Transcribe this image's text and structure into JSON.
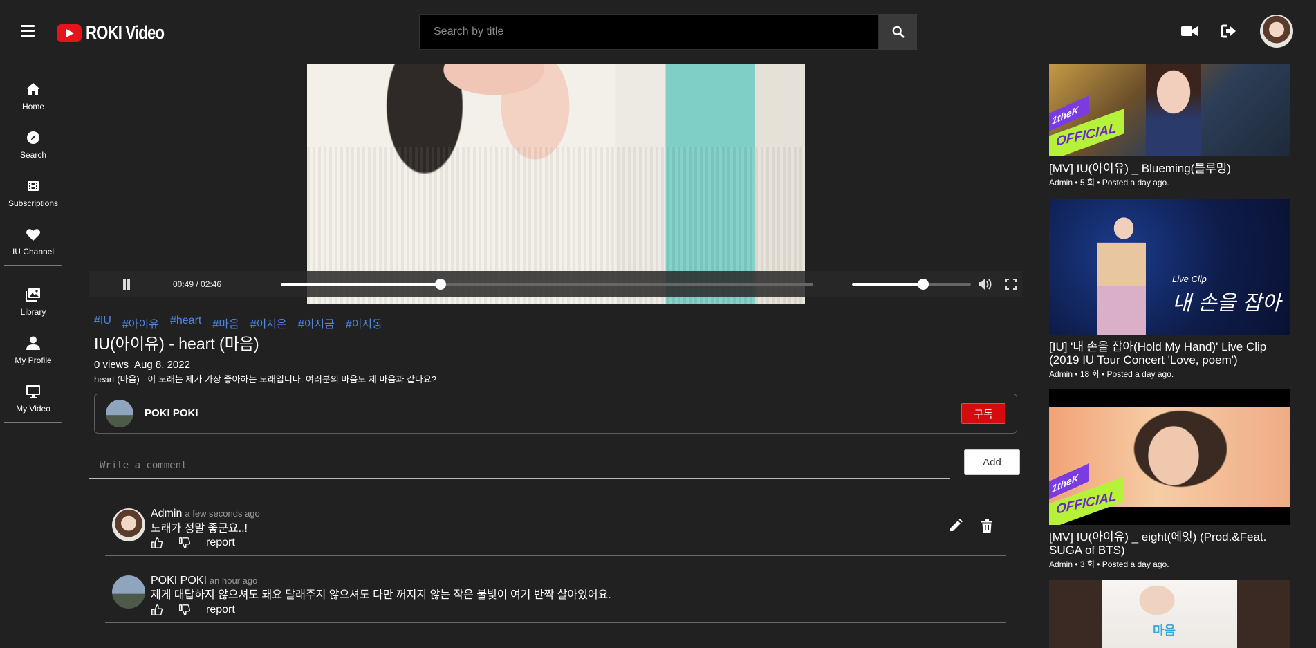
{
  "app": {
    "name": "ROKI Video"
  },
  "search": {
    "placeholder": "Search by title"
  },
  "sidebar": {
    "items": [
      {
        "label": "Home",
        "icon": "home-icon"
      },
      {
        "label": "Search",
        "icon": "compass-icon"
      },
      {
        "label": "Subscriptions",
        "icon": "film-icon"
      },
      {
        "label": "IU Channel",
        "icon": "heart-icon"
      },
      {
        "label": "Library",
        "icon": "photo-library-icon"
      },
      {
        "label": "My Profile",
        "icon": "user-icon"
      },
      {
        "label": "My Video",
        "icon": "monitor-icon"
      }
    ]
  },
  "player": {
    "time": "00:49 / 02:46",
    "progress": 0.3,
    "volume": 0.6
  },
  "video": {
    "tags": [
      "#IU",
      "#아이유",
      "#heart",
      "#마음",
      "#이지은",
      "#이지금",
      "#이지동"
    ],
    "title": "IU(아이유) - heart (마음)",
    "views": "0 views",
    "date": "Aug 8, 2022",
    "description": "heart (마음) - 이 노래는 제가 가장 좋아하는 노래입니다. 여러분의 마음도 제 마음과 같나요?"
  },
  "channel": {
    "name": "POKI POKI",
    "subscribe_label": "구독"
  },
  "comment_form": {
    "placeholder": "Write a comment",
    "add_label": "Add"
  },
  "comments": [
    {
      "author": "Admin",
      "time": "a few seconds ago",
      "text": "노래가 정말 좋군요..!",
      "report": "report"
    },
    {
      "author": "POKI POKI",
      "time": "an hour ago",
      "text": "제게 대답하지 않으셔도 돼요 달래주지 않으셔도 다만 꺼지지 않는 작은 불빛이 여기 반짝 살아있어요.",
      "report": "report"
    }
  ],
  "recommended": [
    {
      "title": "[MV] IU(아이유) _ Blueming(블루밍)",
      "meta": "Admin • 5 회 • Posted a day ago.",
      "badge": "OFFICIAL",
      "badge_small": "1theK"
    },
    {
      "title": "[IU] '내 손을 잡아(Hold My Hand)' Live Clip (2019 IU Tour Concert 'Love, poem')",
      "meta": "Admin • 18 회 • Posted a day ago.",
      "overlay_small": "Live Clip",
      "overlay_big": "내 손을 잡아"
    },
    {
      "title": "[MV] IU(아이유) _ eight(에잇) (Prod.&Feat. SUGA of BTS)",
      "meta": "Admin • 3 회 • Posted a day ago.",
      "badge": "OFFICIAL",
      "badge_small": "1theK"
    },
    {
      "overlay_big": "마음"
    }
  ],
  "colors": {
    "background": "#212121",
    "tag": "#4f86d9",
    "subscribe": "#d40c10",
    "logo": "#e5131a"
  }
}
